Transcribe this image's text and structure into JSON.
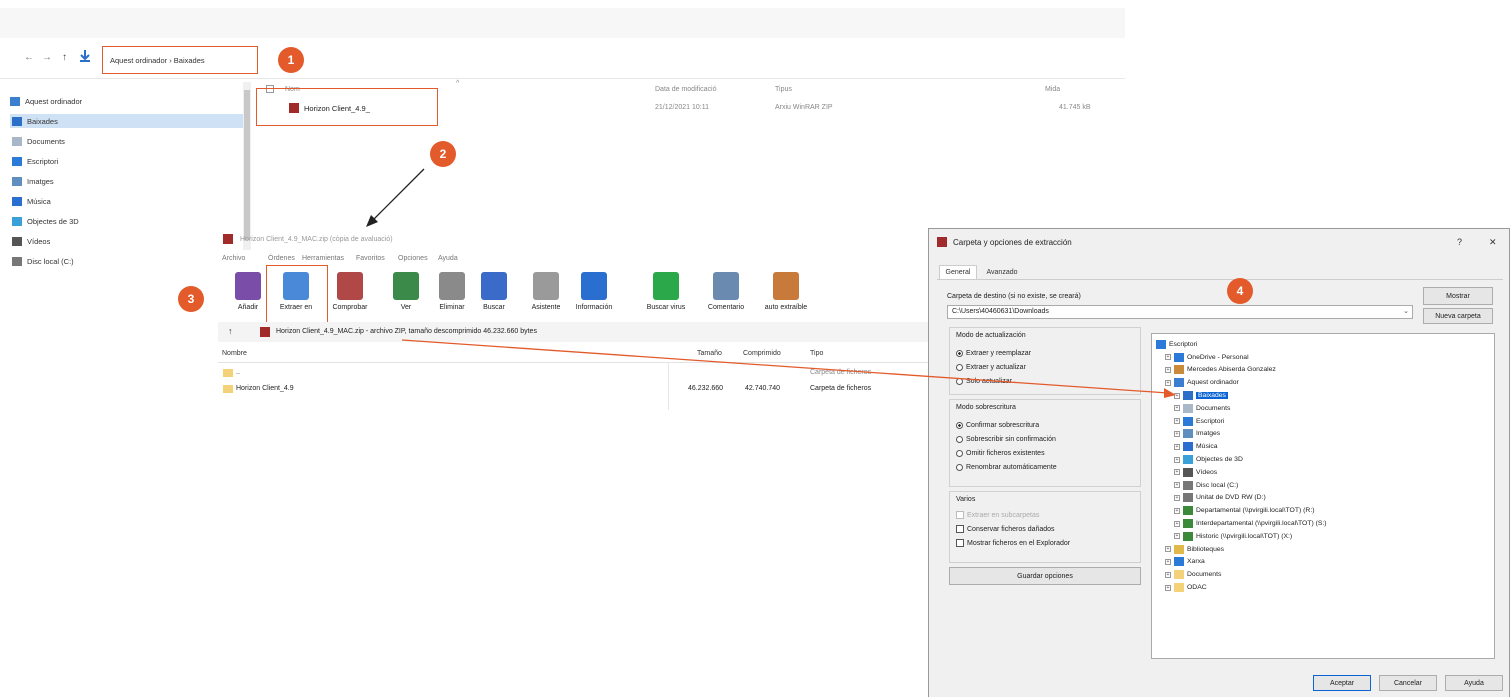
{
  "explorer": {
    "breadcrumb": "Aquest ordinador  ›  Baixades",
    "sidebar": [
      {
        "label": "Aquest ordinador",
        "icon": "computer-icon",
        "color": "#3c7fd1"
      },
      {
        "label": "Baixades",
        "icon": "download-icon",
        "color": "#2b6fc8",
        "selected": true
      },
      {
        "label": "Documents",
        "icon": "document-icon",
        "color": "#a9b8c8"
      },
      {
        "label": "Escriptori",
        "icon": "desktop-icon",
        "color": "#2b7ad8"
      },
      {
        "label": "Imatges",
        "icon": "image-icon",
        "color": "#5e8fbf"
      },
      {
        "label": "Música",
        "icon": "music-icon",
        "color": "#2a6ecf"
      },
      {
        "label": "Objectes de 3D",
        "icon": "cube-icon",
        "color": "#3aa0d8"
      },
      {
        "label": "Vídeos",
        "icon": "video-icon",
        "color": "#555555"
      },
      {
        "label": "Disc local (C:)",
        "icon": "drive-icon",
        "color": "#777777"
      }
    ],
    "columns": [
      "Nom",
      "Data de modificació",
      "Tipus",
      "Mida"
    ],
    "file": {
      "name": "Horizon Client_4.9_",
      "date": "21/12/2021 10:11",
      "type": "Arxiu WinRAR ZIP",
      "size": "41.745 kB"
    }
  },
  "winrar": {
    "title": "Horizon Client_4.9_MAC.zip (còpia de avaluació)",
    "menu": [
      "Archivo",
      "Órdenes",
      "Herramientas",
      "Favoritos",
      "Opciones",
      "Ayuda"
    ],
    "toolbar": [
      "Añadir",
      "Extraer en",
      "Comprobar",
      "Ver",
      "Eliminar",
      "Buscar",
      "Asistente",
      "Información",
      "Buscar virus",
      "Comentario",
      "auto extraíble"
    ],
    "pathbar": "Horizon Client_4.9_MAC.zip - archivo ZIP, tamaño descomprimido 46.232.660 bytes",
    "up_arrow": "↑",
    "columns": [
      "Nombre",
      "Tamaño",
      "Comprimido",
      "Tipo"
    ],
    "rows": [
      {
        "name": "..",
        "size": "",
        "packed": "",
        "type": "Carpeta de ficheros"
      },
      {
        "name": "Horizon Client_4.9",
        "size": "46.232.660",
        "packed": "42.740.740",
        "type": "Carpeta de ficheros"
      }
    ]
  },
  "dialog": {
    "title": "Carpeta y opciones de extracción",
    "help": "?",
    "close": "✕",
    "tabs": [
      "General",
      "Avanzado"
    ],
    "dest_label": "Carpeta de destino (si no existe, se creará)",
    "dest_value": "C:\\Users\\40460631\\Downloads",
    "btn_show": "Mostrar",
    "btn_new_folder": "Nueva carpeta",
    "update_mode": {
      "title": "Modo de actualización",
      "options": [
        {
          "label": "Extraer y reemplazar",
          "on": true
        },
        {
          "label": "Extraer y actualizar",
          "on": false
        },
        {
          "label": "Solo actualizar",
          "on": false
        }
      ]
    },
    "overwrite_mode": {
      "title": "Modo sobrescritura",
      "options": [
        {
          "label": "Confirmar sobrescritura",
          "on": true
        },
        {
          "label": "Sobrescribir sin confirmación",
          "on": false
        },
        {
          "label": "Omitir ficheros existentes",
          "on": false
        },
        {
          "label": "Renombrar automáticamente",
          "on": false
        }
      ]
    },
    "misc": {
      "title": "Varios",
      "options": [
        "Extraer en subcarpetas",
        "Conservar ficheros dañados",
        "Mostrar ficheros en el Explorador"
      ]
    },
    "save_btn": "Guardar opciones",
    "tree": [
      {
        "label": "Escriptori",
        "level": 0,
        "icon": "desktop-icon",
        "color": "#2b7ad8"
      },
      {
        "label": "OneDrive - Personal",
        "level": 1,
        "icon": "cloud-icon",
        "color": "#2b7ad8"
      },
      {
        "label": "Mercedes Abiserda Gonzalez",
        "level": 1,
        "icon": "user-icon",
        "color": "#c98a3a"
      },
      {
        "label": "Aquest ordinador",
        "level": 1,
        "icon": "computer-icon",
        "color": "#3c7fd1"
      },
      {
        "label": "Baixades",
        "level": 2,
        "icon": "download-icon",
        "color": "#2b6fc8",
        "selected": true
      },
      {
        "label": "Documents",
        "level": 2,
        "icon": "document-icon",
        "color": "#a9b8c8"
      },
      {
        "label": "Escriptori",
        "level": 2,
        "icon": "desktop-icon",
        "color": "#2b7ad8"
      },
      {
        "label": "Imatges",
        "level": 2,
        "icon": "image-icon",
        "color": "#5e8fbf"
      },
      {
        "label": "Música",
        "level": 2,
        "icon": "music-icon",
        "color": "#2a6ecf"
      },
      {
        "label": "Objectes de 3D",
        "level": 2,
        "icon": "cube-icon",
        "color": "#3aa0d8"
      },
      {
        "label": "Vídeos",
        "level": 2,
        "icon": "video-icon",
        "color": "#555555"
      },
      {
        "label": "Disc local (C:)",
        "level": 2,
        "icon": "drive-icon",
        "color": "#777777"
      },
      {
        "label": "Unitat de DVD RW (D:)",
        "level": 2,
        "icon": "dvd-icon",
        "color": "#777777"
      },
      {
        "label": "Departamental (\\\\pvirgili.local\\TOT) (R:)",
        "level": 2,
        "icon": "network-drive-icon",
        "color": "#3a8a3a"
      },
      {
        "label": "Interdepartamental (\\\\pvirgili.local\\TOT) (S:)",
        "level": 2,
        "icon": "network-drive-icon",
        "color": "#3a8a3a"
      },
      {
        "label": "Historic (\\\\pvirgili.local\\TOT) (X:)",
        "level": 2,
        "icon": "network-drive-icon",
        "color": "#3a8a3a"
      },
      {
        "label": "Biblioteques",
        "level": 1,
        "icon": "library-icon",
        "color": "#e0b84c"
      },
      {
        "label": "Xarxa",
        "level": 1,
        "icon": "network-icon",
        "color": "#2b7ad8"
      },
      {
        "label": "Documents",
        "level": 1,
        "icon": "folder-icon",
        "color": "#f3d27a"
      },
      {
        "label": "ODAC",
        "level": 1,
        "icon": "folder-icon",
        "color": "#f3d27a"
      }
    ],
    "buttons": [
      "Aceptar",
      "Cancelar",
      "Ayuda"
    ]
  },
  "callouts": [
    "1",
    "2",
    "3",
    "4"
  ],
  "colors": {
    "accent": "#e35a2b",
    "selection": "#cfe1f5",
    "tree_selection": "#0a64d4"
  }
}
